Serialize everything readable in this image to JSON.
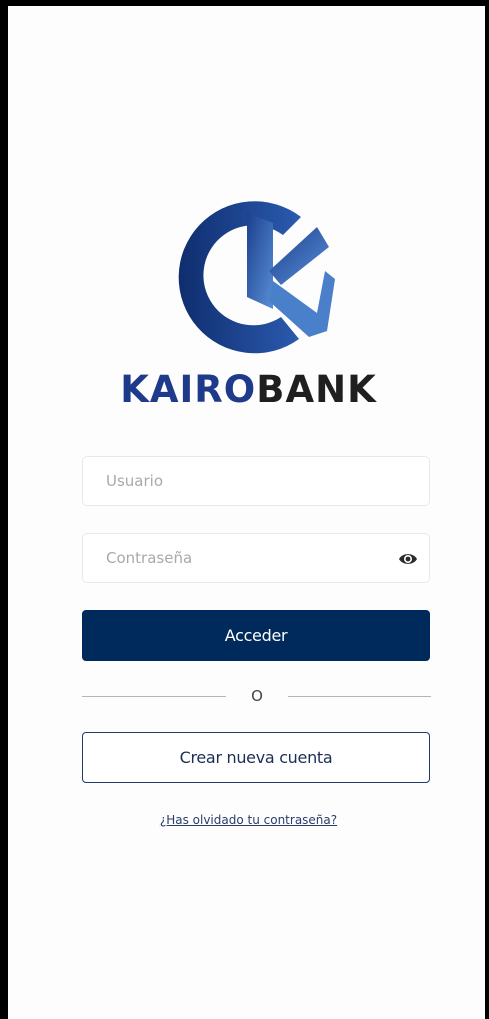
{
  "brand": {
    "name_part1": "KAIRO",
    "name_part2": "BANK",
    "logo_icon": "kairobank-logo-icon",
    "colors": {
      "primary": "#1e3a8a",
      "dark": "#1f1f1f",
      "button": "#002a5c"
    }
  },
  "login": {
    "username_placeholder": "Usuario",
    "password_placeholder": "Contraseña",
    "password_toggle_icon": "eye-icon",
    "submit_label": "Acceder",
    "divider_label": "O",
    "create_account_label": "Crear nueva cuenta",
    "forgot_password_label": "¿Has olvidado tu contraseña?"
  }
}
